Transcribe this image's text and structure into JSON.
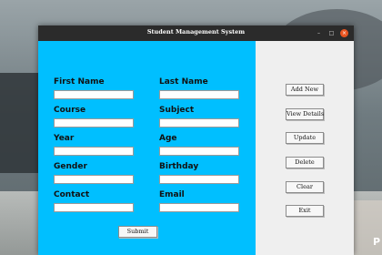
{
  "window": {
    "title": "Student Management System",
    "controls": {
      "minimize": "–",
      "maximize": "□",
      "close": "×"
    }
  },
  "form": {
    "fields": [
      {
        "label": "First Name",
        "value": ""
      },
      {
        "label": "Last Name",
        "value": ""
      },
      {
        "label": "Course",
        "value": ""
      },
      {
        "label": "Subject",
        "value": ""
      },
      {
        "label": "Year",
        "value": ""
      },
      {
        "label": "Age",
        "value": ""
      },
      {
        "label": "Gender",
        "value": ""
      },
      {
        "label": "Birthday",
        "value": ""
      },
      {
        "label": "Contact",
        "value": ""
      },
      {
        "label": "Email",
        "value": ""
      }
    ],
    "submit_label": "Submit"
  },
  "actions": {
    "add_new": "Add New",
    "view_details": "View Details",
    "update": "Update",
    "delete": "Delete",
    "clear": "Clear",
    "exit": "Exit"
  },
  "background": {
    "corner_text": "P"
  },
  "colors": {
    "form_bg": "#00bfff",
    "titlebar": "#2b2b2b",
    "close_button": "#e95420"
  }
}
